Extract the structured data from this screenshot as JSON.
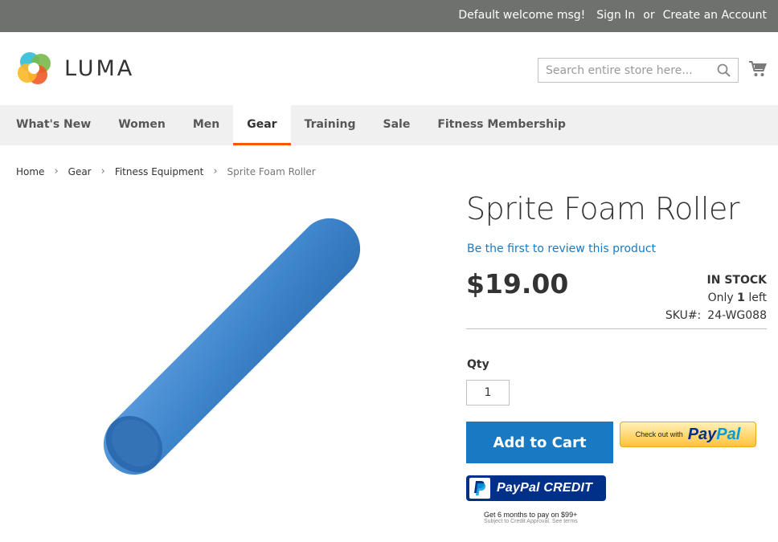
{
  "topbar": {
    "welcome": "Default welcome msg!",
    "sign_in": "Sign In",
    "or": "or",
    "create_account": "Create an Account"
  },
  "header": {
    "logo_text": "LUMA",
    "search_placeholder": "Search entire store here...",
    "search_icon": "search-icon",
    "cart_icon": "cart-icon"
  },
  "nav": {
    "items": [
      {
        "label": "What's New"
      },
      {
        "label": "Women"
      },
      {
        "label": "Men"
      },
      {
        "label": "Gear",
        "active": true
      },
      {
        "label": "Training"
      },
      {
        "label": "Sale"
      },
      {
        "label": "Fitness Membership"
      }
    ]
  },
  "breadcrumbs": {
    "items": [
      "Home",
      "Gear",
      "Fitness Equipment"
    ],
    "current": "Sprite Foam Roller"
  },
  "product": {
    "title": "Sprite Foam Roller",
    "review_link": "Be the first to review this product",
    "price": "$19.00",
    "stock_status": "IN STOCK",
    "only_prefix": "Only",
    "only_count": "1",
    "only_suffix": "left",
    "sku_label": "SKU#:",
    "sku": "24-WG088",
    "qty_label": "Qty",
    "qty_value": "1",
    "add_to_cart": "Add to Cart"
  },
  "paypal": {
    "checkout_text": "Check out with",
    "pay": "Pay",
    "pal": "Pal",
    "credit_label": "PayPal CREDIT",
    "credit_line1": "Get 6 months to pay on $99+",
    "credit_line2": "Subject to Credit Approval. See terms"
  },
  "colors": {
    "accent": "#1979c3",
    "nav_active": "#ff5501",
    "topbar": "#6e716e",
    "product_blue": "#3f86cc"
  }
}
